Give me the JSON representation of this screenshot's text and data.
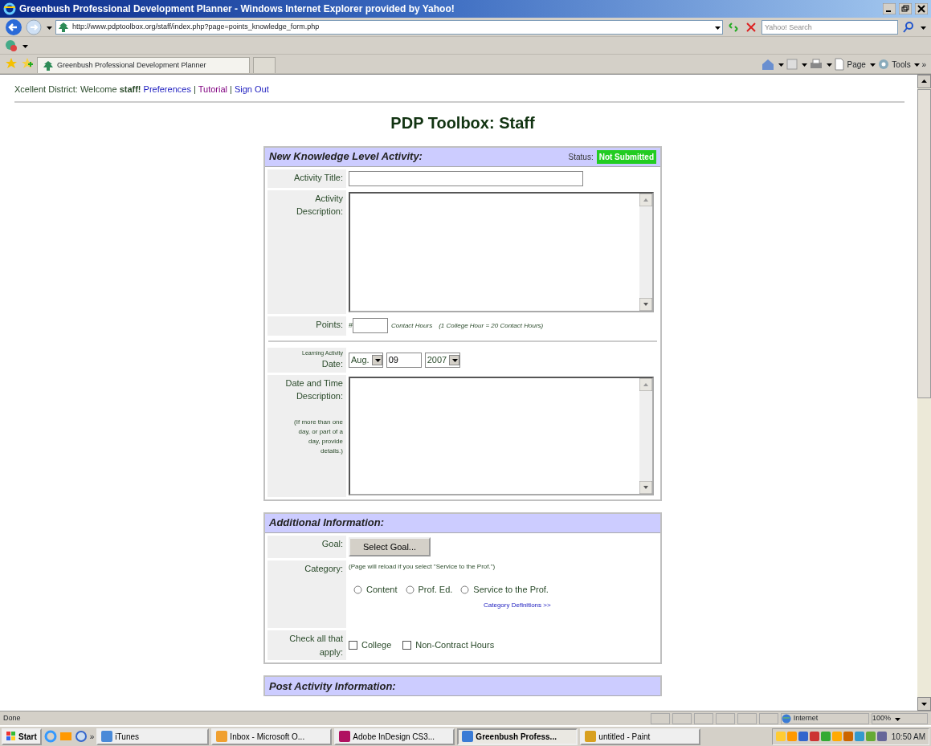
{
  "window": {
    "title": "Greenbush Professional Development Planner - Windows Internet Explorer provided by Yahoo!"
  },
  "address_bar": {
    "url": "http://www.pdptoolbox.org/staff/index.php?page=points_knowledge_form.php"
  },
  "search": {
    "placeholder": "Yahoo! Search"
  },
  "tabs": [
    {
      "label": "Greenbush Professional Development Planner",
      "selected": true
    }
  ],
  "command_bar": {
    "items": [
      "Page",
      "Tools"
    ],
    "more": "»"
  },
  "page": {
    "district": "Xcellent District:",
    "welcome": "Welcome **staff!**",
    "separator": "|",
    "links": [
      {
        "label": "Preferences",
        "visited": false
      },
      {
        "label": "Tutorial",
        "visited": true
      },
      {
        "label": "Sign Out",
        "visited": false
      }
    ],
    "heading": "PDP Toolbox: Staff",
    "sections": [
      {
        "title": "New Knowledge Level Activity:",
        "status_label": "Status:",
        "status": "Not Submitted",
        "fields": [
          {
            "kind": "text",
            "label": "Activity Title:"
          },
          {
            "kind": "textarea",
            "label": "Activity Description:"
          },
          {
            "kind": "points",
            "label": "Points:",
            "prefix": "#",
            "unit": "Contact Hours",
            "note": "(1 College Hour = 20 Contact Hours)"
          },
          {
            "kind": "divider"
          },
          {
            "kind": "date",
            "label": "Learning Activity",
            "label2": "Date:",
            "month": "Aug.",
            "day": "09",
            "year": "2007"
          },
          {
            "kind": "textarea",
            "label": "Date and Time Description:",
            "note": "(If more than one day, or part of a day, provide details.)"
          }
        ]
      },
      {
        "title": "Additional Information:",
        "fields": [
          {
            "kind": "button",
            "label": "Goal:",
            "button": "Select Goal..."
          },
          {
            "kind": "radios",
            "label": "Category:",
            "note": "(Page will reload if you select \"Service to the Prof.\")",
            "options": [
              {
                "label": "Content",
                "selected": false
              },
              {
                "label": "Prof. Ed.",
                "selected": false
              },
              {
                "label": "Service to the Prof.",
                "selected": false
              }
            ],
            "link": "Category Definitions >>"
          },
          {
            "kind": "checks",
            "label": "Check all that apply:",
            "options": [
              {
                "label": "College",
                "checked": false
              },
              {
                "label": "Non-Contract Hours",
                "checked": false
              }
            ]
          }
        ]
      },
      {
        "title": "Post Activity Information:"
      }
    ]
  },
  "status_bar": {
    "text": "Done",
    "zone": "Internet",
    "zoom": "100%"
  },
  "taskbar": {
    "start": "Start",
    "more": "»",
    "items": [
      {
        "label": "iTunes",
        "selected": false
      },
      {
        "label": "Inbox - Microsoft O...",
        "selected": false
      },
      {
        "label": "Adobe InDesign CS3...",
        "selected": false
      },
      {
        "label": "Greenbush Profess...",
        "selected": true
      },
      {
        "label": "untitled - Paint",
        "selected": false
      }
    ],
    "clock": "10:50 AM"
  }
}
